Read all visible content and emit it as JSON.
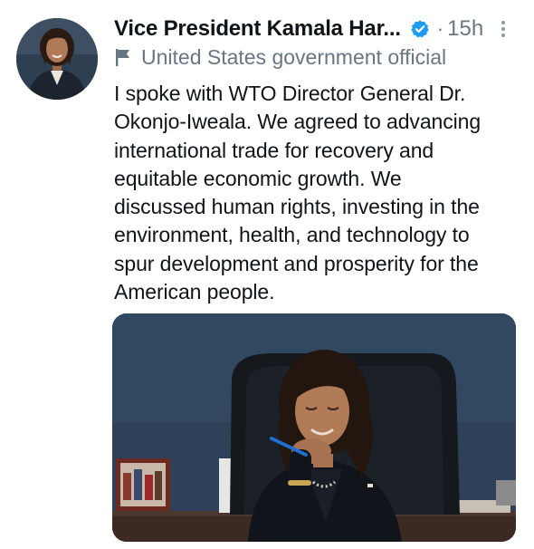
{
  "tweet": {
    "author": {
      "display_name": "Vice President Kamala Har...",
      "verified_icon": "verified-badge-icon",
      "avatar_icon": "avatar"
    },
    "separator": "·",
    "timestamp": "15h",
    "more_icon": "more-vertical-icon",
    "label": {
      "icon": "flag-icon",
      "text": "United States government official"
    },
    "text_lines": [
      "I spoke with WTO Director General Dr.",
      "Okonjo-Iweala. We agreed to advancing",
      "international trade for recovery and",
      "equitable economic growth. We",
      "discussed human rights, investing in the",
      "environment, health, and technology to",
      "spur development and prosperity for the",
      "American people."
    ],
    "media": {
      "type": "photo"
    }
  },
  "colors": {
    "primary_text": "#0f1419",
    "secondary_text": "#687684",
    "verified_blue": "#1d9bf0",
    "photo_wall": "#2e4158"
  }
}
